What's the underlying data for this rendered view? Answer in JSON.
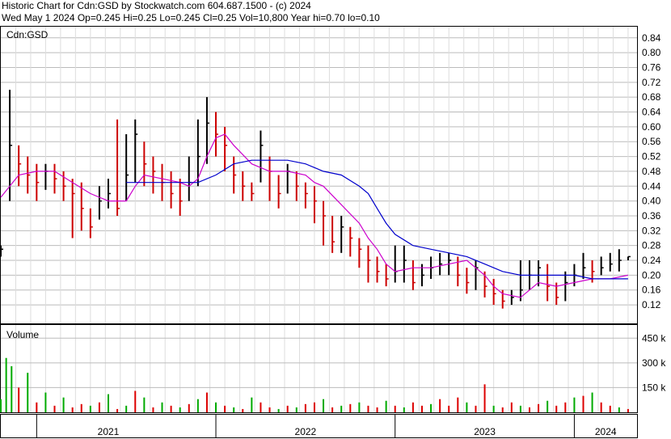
{
  "header": {
    "line1": "Historic Chart for Cdn:GSD by Stockwatch.com 604.687.1500 - (c) 2024",
    "line2": "Wed May  1 2024   Op=0.245   Hi=0.25   Lo=0.245   Cl=0.25   Vol=10,800   Year hi=0.70   lo=0.10"
  },
  "price_panel": {
    "label": "Cdn:GSD"
  },
  "volume_panel": {
    "label": "Volume"
  },
  "colors": {
    "up_bar": "#000000",
    "down_bar": "#cc0000",
    "ma_short": "#cc00cc",
    "ma_long": "#0000cc",
    "vol_up": "#00aa00",
    "vol_down": "#dd0000",
    "grid": "#bbbbbb",
    "frame": "#000000"
  },
  "chart_data": [
    {
      "type": "line",
      "title": "Cdn:GSD",
      "y_ticks": [
        "0.84",
        "0.80",
        "0.76",
        "0.72",
        "0.68",
        "0.64",
        "0.60",
        "0.56",
        "0.52",
        "0.48",
        "0.44",
        "0.40",
        "0.36",
        "0.32",
        "0.28",
        "0.24",
        "0.20",
        "0.16",
        "0.12"
      ],
      "ylim": [
        0.07,
        0.87
      ],
      "x_ticks": [
        "2021",
        "2022",
        "2023",
        "2024"
      ],
      "xlim": [
        2020.8,
        2024.35
      ],
      "grid": true,
      "series": [
        {
          "kind": "price",
          "x": [
            2020.8,
            2020.85,
            2020.9,
            2020.95,
            2021.0,
            2021.05,
            2021.1,
            2021.15,
            2021.2,
            2021.25,
            2021.3,
            2021.35,
            2021.4,
            2021.45,
            2021.5,
            2021.55,
            2021.6,
            2021.65,
            2021.7,
            2021.75,
            2021.8,
            2021.85,
            2021.9,
            2021.95,
            2022.0,
            2022.05,
            2022.1,
            2022.15,
            2022.2,
            2022.25,
            2022.3,
            2022.35,
            2022.4,
            2022.45,
            2022.5,
            2022.55,
            2022.6,
            2022.65,
            2022.7,
            2022.75,
            2022.8,
            2022.85,
            2022.9,
            2022.95,
            2023.0,
            2023.05,
            2023.1,
            2023.15,
            2023.2,
            2023.25,
            2023.3,
            2023.35,
            2023.4,
            2023.45,
            2023.5,
            2023.55,
            2023.6,
            2023.65,
            2023.7,
            2023.75,
            2023.8,
            2023.85,
            2023.9,
            2023.95,
            2024.0,
            2024.05,
            2024.1,
            2024.15,
            2024.2,
            2024.25,
            2024.3
          ],
          "y": [
            0.27,
            0.55,
            0.5,
            0.47,
            0.45,
            0.48,
            0.46,
            0.44,
            0.42,
            0.38,
            0.33,
            0.4,
            0.42,
            0.38,
            0.47,
            0.58,
            0.5,
            0.48,
            0.45,
            0.42,
            0.4,
            0.45,
            0.52,
            0.61,
            0.58,
            0.55,
            0.47,
            0.44,
            0.42,
            0.55,
            0.48,
            0.42,
            0.48,
            0.44,
            0.42,
            0.4,
            0.36,
            0.29,
            0.33,
            0.3,
            0.27,
            0.24,
            0.21,
            0.19,
            0.21,
            0.24,
            0.18,
            0.2,
            0.22,
            0.23,
            0.24,
            0.2,
            0.18,
            0.22,
            0.17,
            0.15,
            0.13,
            0.14,
            0.16,
            0.2,
            0.22,
            0.17,
            0.14,
            0.18,
            0.2,
            0.22,
            0.21,
            0.22,
            0.23,
            0.24,
            0.25
          ],
          "hi": [
            0.28,
            0.7,
            0.55,
            0.52,
            0.5,
            0.5,
            0.5,
            0.48,
            0.46,
            0.45,
            0.38,
            0.44,
            0.46,
            0.62,
            0.58,
            0.62,
            0.56,
            0.52,
            0.5,
            0.48,
            0.46,
            0.52,
            0.62,
            0.68,
            0.64,
            0.6,
            0.52,
            0.48,
            0.45,
            0.59,
            0.52,
            0.47,
            0.5,
            0.48,
            0.45,
            0.44,
            0.4,
            0.36,
            0.36,
            0.33,
            0.3,
            0.28,
            0.25,
            0.23,
            0.28,
            0.28,
            0.24,
            0.23,
            0.25,
            0.26,
            0.26,
            0.25,
            0.22,
            0.24,
            0.21,
            0.19,
            0.16,
            0.16,
            0.24,
            0.24,
            0.24,
            0.23,
            0.18,
            0.21,
            0.23,
            0.26,
            0.24,
            0.25,
            0.26,
            0.27,
            0.25
          ],
          "lo": [
            0.25,
            0.4,
            0.44,
            0.42,
            0.4,
            0.43,
            0.42,
            0.4,
            0.3,
            0.32,
            0.3,
            0.35,
            0.38,
            0.36,
            0.4,
            0.45,
            0.44,
            0.42,
            0.4,
            0.38,
            0.36,
            0.4,
            0.44,
            0.5,
            0.52,
            0.48,
            0.42,
            0.4,
            0.4,
            0.45,
            0.4,
            0.38,
            0.42,
            0.4,
            0.38,
            0.34,
            0.28,
            0.26,
            0.26,
            0.25,
            0.22,
            0.18,
            0.18,
            0.17,
            0.18,
            0.18,
            0.16,
            0.17,
            0.19,
            0.2,
            0.2,
            0.17,
            0.15,
            0.16,
            0.14,
            0.12,
            0.11,
            0.12,
            0.13,
            0.16,
            0.17,
            0.13,
            0.12,
            0.13,
            0.17,
            0.19,
            0.18,
            0.2,
            0.21,
            0.21,
            0.24
          ]
        },
        {
          "kind": "ma_short",
          "x": [
            2020.8,
            2020.9,
            2021.0,
            2021.1,
            2021.2,
            2021.3,
            2021.4,
            2021.5,
            2021.55,
            2021.6,
            2021.7,
            2021.8,
            2021.85,
            2021.9,
            2021.95,
            2022.0,
            2022.05,
            2022.1,
            2022.2,
            2022.3,
            2022.4,
            2022.5,
            2022.55,
            2022.6,
            2022.7,
            2022.8,
            2022.85,
            2022.9,
            2022.95,
            2023.0,
            2023.1,
            2023.2,
            2023.3,
            2023.4,
            2023.5,
            2023.55,
            2023.6,
            2023.7,
            2023.8,
            2023.9,
            2024.0,
            2024.1,
            2024.2,
            2024.3
          ],
          "y": [
            0.41,
            0.47,
            0.48,
            0.48,
            0.45,
            0.42,
            0.4,
            0.4,
            0.44,
            0.47,
            0.46,
            0.45,
            0.44,
            0.46,
            0.52,
            0.57,
            0.58,
            0.55,
            0.5,
            0.48,
            0.48,
            0.47,
            0.45,
            0.44,
            0.39,
            0.34,
            0.3,
            0.27,
            0.23,
            0.21,
            0.22,
            0.22,
            0.23,
            0.24,
            0.2,
            0.17,
            0.15,
            0.14,
            0.18,
            0.17,
            0.18,
            0.19,
            0.19,
            0.2
          ]
        },
        {
          "kind": "ma_long",
          "x": [
            2021.5,
            2021.7,
            2021.9,
            2022.0,
            2022.1,
            2022.2,
            2022.3,
            2022.4,
            2022.5,
            2022.55,
            2022.6,
            2022.7,
            2022.8,
            2022.85,
            2022.9,
            2022.95,
            2023.0,
            2023.1,
            2023.2,
            2023.3,
            2023.4,
            2023.5,
            2023.6,
            2023.7,
            2023.8,
            2023.9,
            2024.0,
            2024.1,
            2024.2,
            2024.3
          ],
          "y": [
            0.45,
            0.45,
            0.45,
            0.47,
            0.5,
            0.51,
            0.51,
            0.51,
            0.5,
            0.49,
            0.48,
            0.47,
            0.44,
            0.42,
            0.38,
            0.34,
            0.31,
            0.28,
            0.27,
            0.26,
            0.25,
            0.23,
            0.21,
            0.2,
            0.2,
            0.2,
            0.2,
            0.19,
            0.19,
            0.19
          ]
        }
      ]
    },
    {
      "type": "bar",
      "title": "Volume",
      "y_ticks": [
        "450 k",
        "300 k",
        "150 k"
      ],
      "ylim": [
        0,
        530
      ],
      "xlim": [
        2020.8,
        2024.35
      ],
      "x": [
        2020.8,
        2020.83,
        2020.86,
        2020.9,
        2020.95,
        2021.0,
        2021.05,
        2021.1,
        2021.15,
        2021.2,
        2021.25,
        2021.3,
        2021.35,
        2021.4,
        2021.45,
        2021.5,
        2021.55,
        2021.6,
        2021.65,
        2021.7,
        2021.75,
        2021.8,
        2021.85,
        2021.9,
        2021.95,
        2022.0,
        2022.05,
        2022.1,
        2022.15,
        2022.2,
        2022.25,
        2022.3,
        2022.35,
        2022.4,
        2022.45,
        2022.5,
        2022.55,
        2022.6,
        2022.65,
        2022.7,
        2022.75,
        2022.8,
        2022.85,
        2022.9,
        2022.95,
        2023.0,
        2023.05,
        2023.1,
        2023.15,
        2023.2,
        2023.25,
        2023.3,
        2023.35,
        2023.4,
        2023.45,
        2023.5,
        2023.55,
        2023.6,
        2023.65,
        2023.7,
        2023.75,
        2023.8,
        2023.85,
        2023.9,
        2023.95,
        2024.0,
        2024.05,
        2024.1,
        2024.15,
        2024.2,
        2024.25,
        2024.3
      ],
      "values": [
        80,
        330,
        280,
        150,
        240,
        60,
        120,
        40,
        90,
        30,
        50,
        40,
        60,
        110,
        20,
        40,
        130,
        90,
        30,
        60,
        40,
        30,
        50,
        80,
        120,
        60,
        40,
        30,
        20,
        90,
        60,
        30,
        20,
        40,
        30,
        50,
        60,
        80,
        30,
        40,
        50,
        60,
        40,
        30,
        70,
        40,
        30,
        60,
        40,
        50,
        80,
        40,
        90,
        60,
        40,
        170,
        40,
        30,
        60,
        40,
        30,
        50,
        70,
        40,
        60,
        90,
        100,
        120,
        60,
        40,
        30,
        20
      ],
      "up": [
        true,
        true,
        true,
        false,
        true,
        false,
        true,
        false,
        true,
        false,
        false,
        true,
        false,
        true,
        false,
        true,
        false,
        true,
        false,
        true,
        false,
        true,
        false,
        true,
        false,
        true,
        false,
        true,
        false,
        true,
        false,
        false,
        true,
        false,
        true,
        false,
        false,
        true,
        false,
        true,
        false,
        true,
        false,
        false,
        true,
        false,
        true,
        false,
        false,
        true,
        false,
        false,
        false,
        true,
        false,
        false,
        true,
        false,
        false,
        true,
        false,
        false,
        true,
        false,
        false,
        true,
        false,
        true,
        false,
        false,
        true,
        false
      ]
    }
  ]
}
